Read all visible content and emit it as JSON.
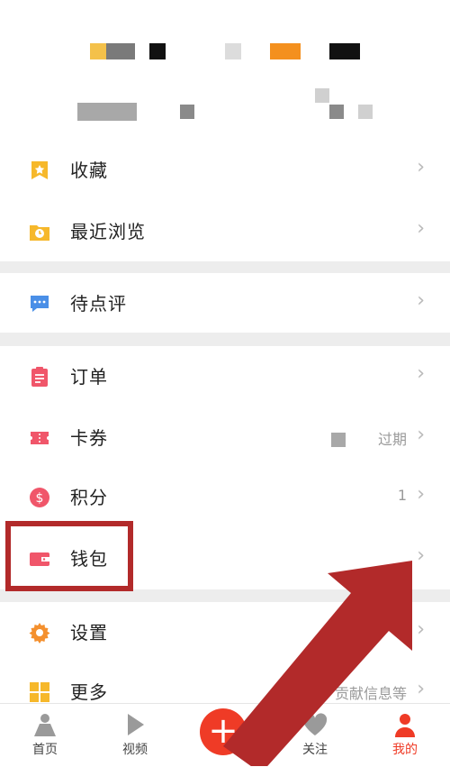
{
  "menu": {
    "favorites": "收藏",
    "recent": "最近浏览",
    "to_review": "待点评",
    "orders": "订单",
    "coupons": "卡券",
    "coupons_extra": "过期",
    "points": "积分",
    "points_extra": "1",
    "wallet": "钱包",
    "settings": "设置",
    "more": "更多",
    "more_extra": "贡献信息等"
  },
  "tabbar": {
    "home": "首页",
    "video": "视频",
    "follow": "关注",
    "mine": "我的"
  },
  "colors": {
    "accent": "#ef3b26",
    "highlight": "#b22a2a"
  }
}
